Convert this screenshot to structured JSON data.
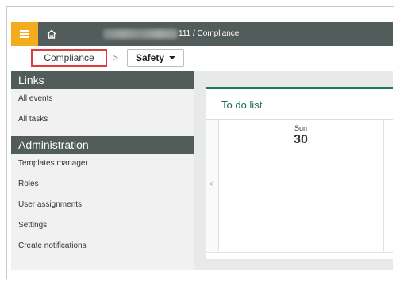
{
  "topbar": {
    "path_text": "111 / Compliance",
    "accent_color": "#f2ac1d",
    "bar_color": "#525c5a"
  },
  "breadcrumb": {
    "first": "Compliance",
    "separator": ">",
    "dropdown_label": "Safety"
  },
  "sidebar": {
    "links_heading": "Links",
    "links": [
      "All events",
      "All tasks"
    ],
    "admin_heading": "Administration",
    "admin_items": [
      "Templates manager",
      "Roles",
      "User assignments",
      "Settings",
      "Create notifications"
    ]
  },
  "main": {
    "panel_title": "To do list",
    "day_name": "Sun",
    "day_number": "30",
    "nav_prev": "<"
  }
}
